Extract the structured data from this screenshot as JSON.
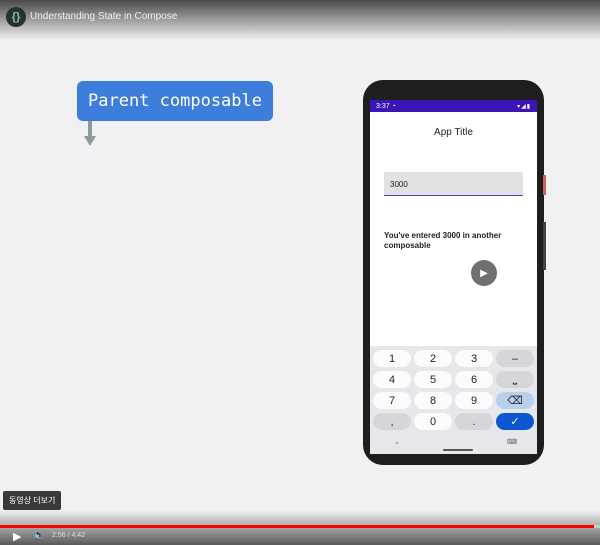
{
  "video": {
    "title": "Understanding State in Compose",
    "more_videos_label": "동영상 더보기",
    "current_time": "2:56",
    "total_time": "4:42",
    "time_separator": " / ",
    "progress_fraction": 0.99
  },
  "slide": {
    "label": "Parent composable"
  },
  "phone": {
    "status_time": "3:37",
    "status_icon_text": "◔",
    "status_right_icons": "▾◢▮",
    "app_title": "App Title",
    "input_value": "3000",
    "entered_text": "You've entered 3000 in another composable"
  },
  "keyboard": {
    "row1": [
      "1",
      "2",
      "3",
      "–"
    ],
    "row2": [
      "4",
      "5",
      "6",
      "⎵"
    ],
    "row3": [
      "7",
      "8",
      "9",
      "⌫"
    ],
    "row4": [
      ",",
      "0",
      ".",
      "✓"
    ],
    "nav_down": "⌄",
    "nav_keyboard": "⌨"
  },
  "colors": {
    "label_blue": "#3d7ddc",
    "status_bar": "#3a16b8",
    "done_key": "#0b57d0",
    "progress_red": "#ff0000"
  }
}
